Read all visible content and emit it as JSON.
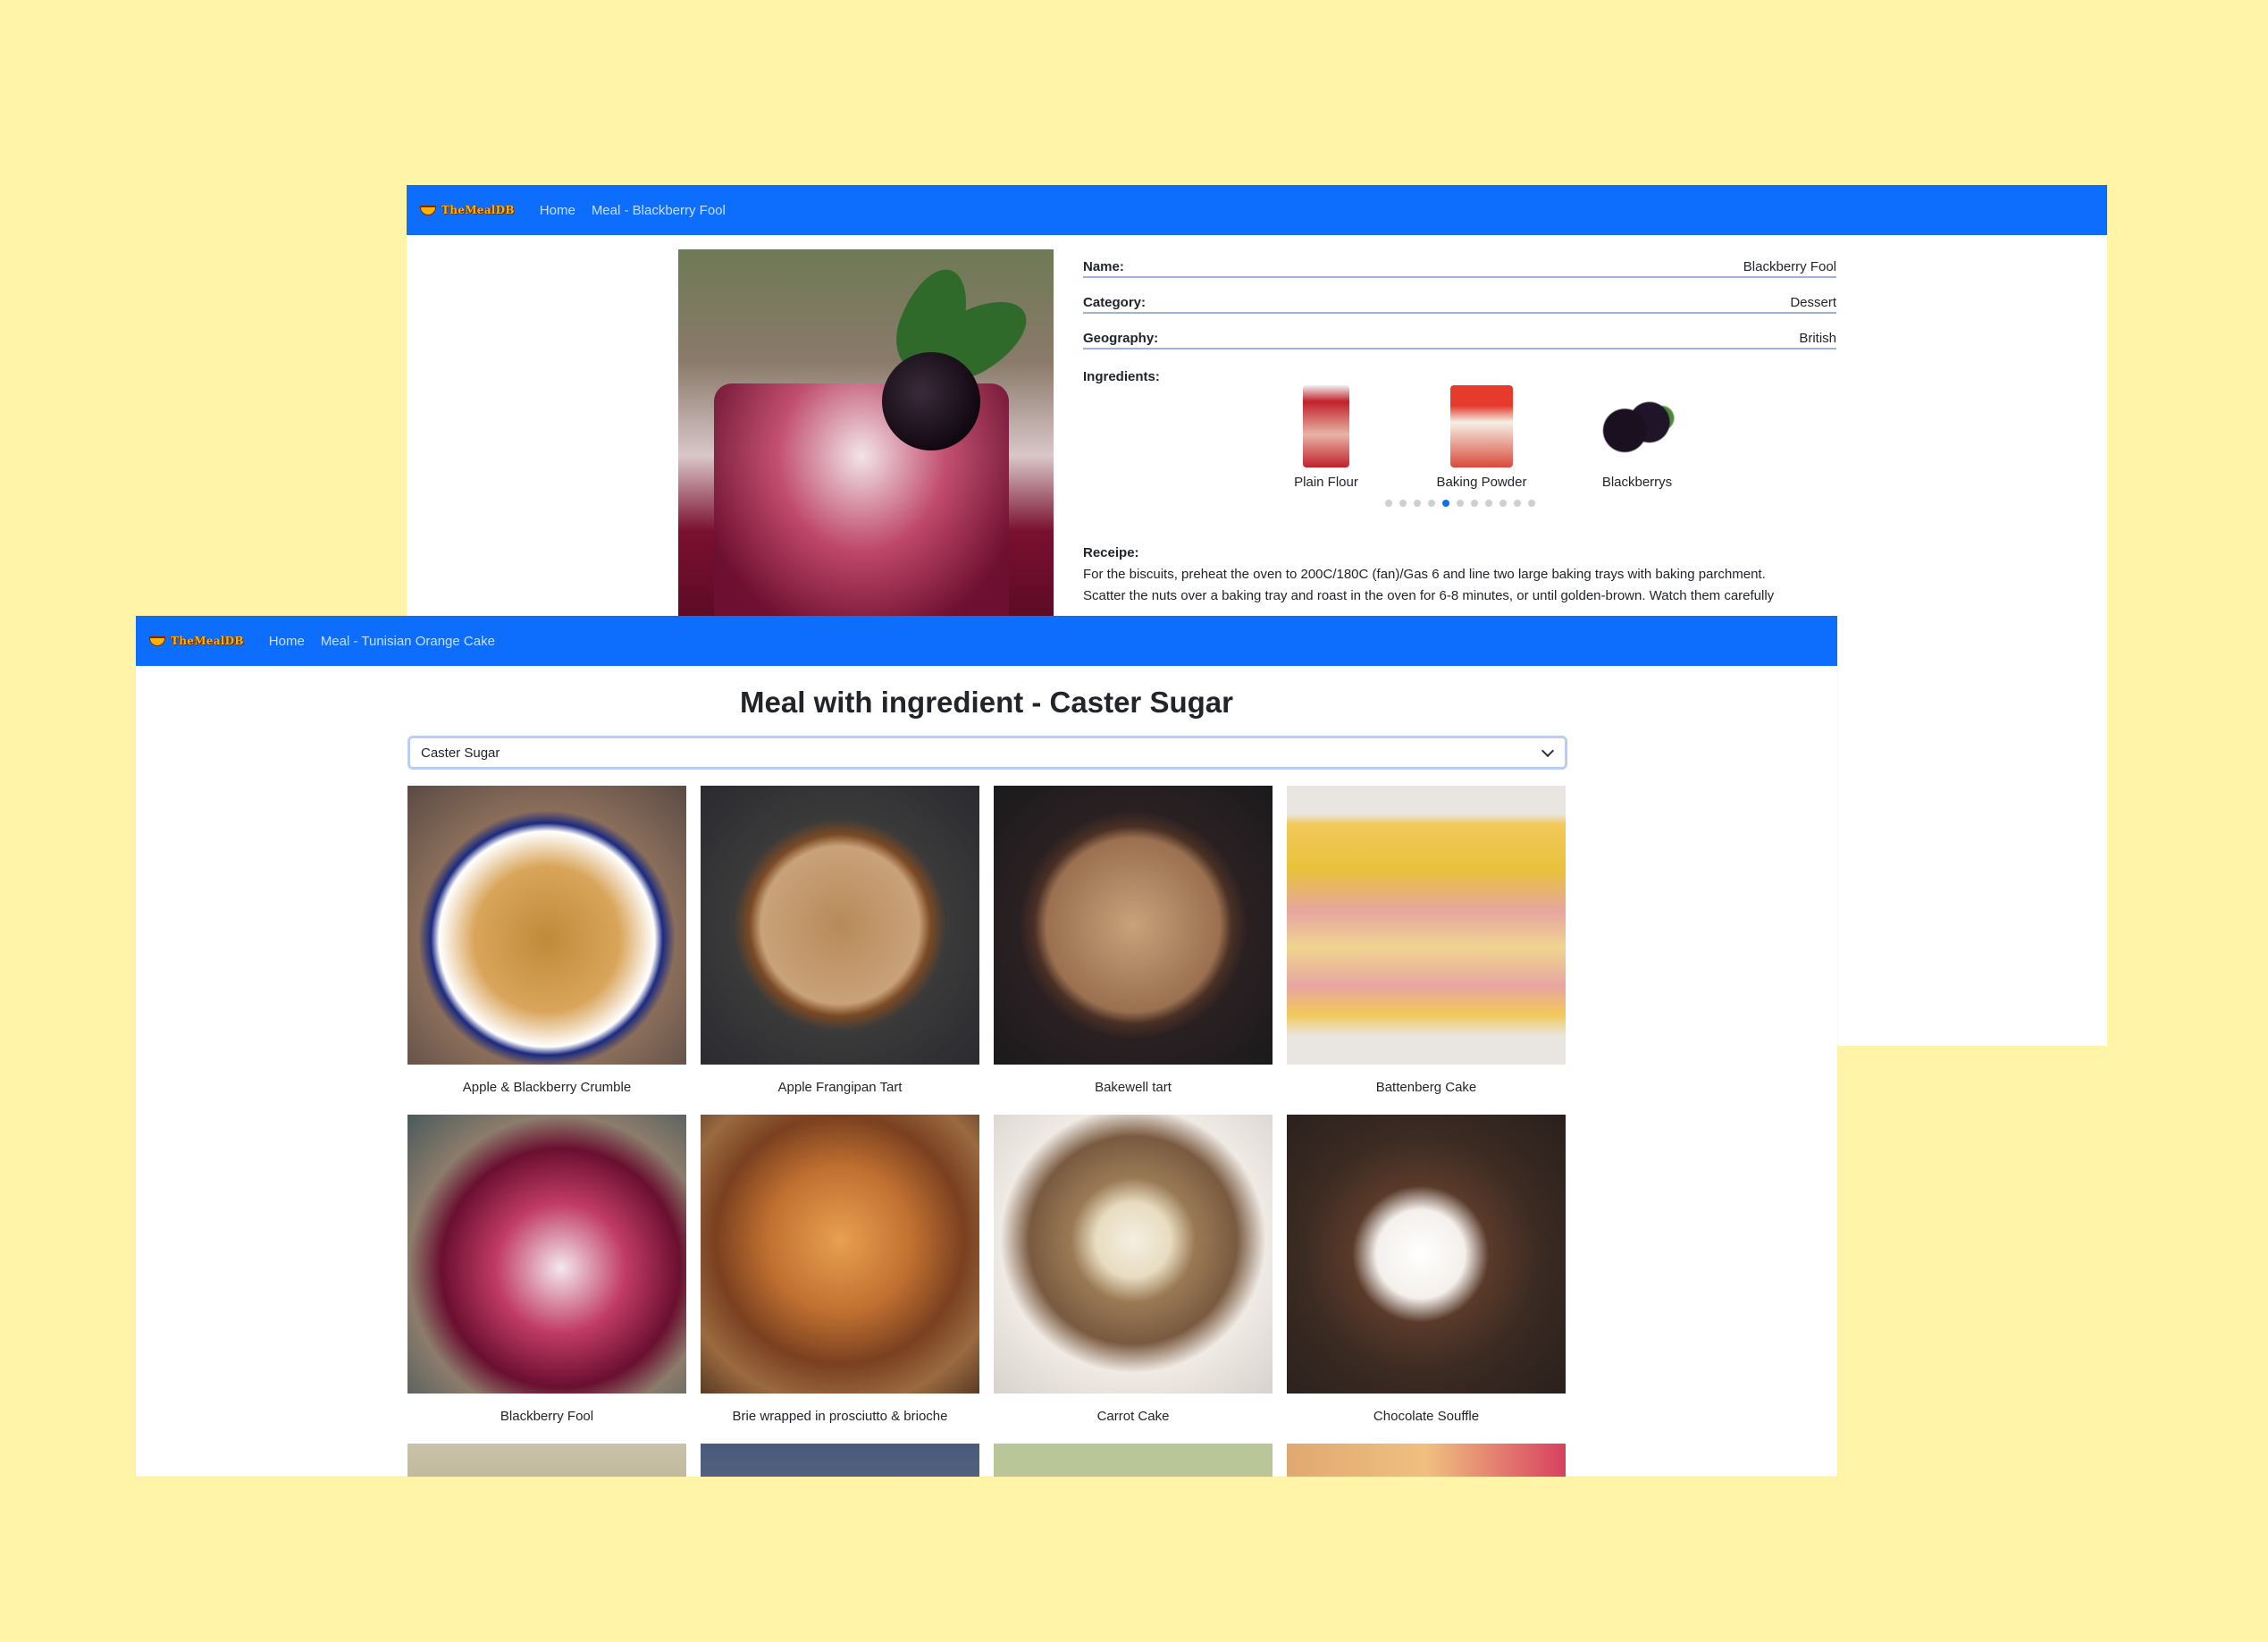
{
  "back_window": {
    "navbar": {
      "logo": "TheMealDB",
      "links": [
        "Home",
        "Meal - Blackberry Fool"
      ]
    },
    "details": {
      "name_label": "Name:",
      "name_value": "Blackberry Fool",
      "category_label": "Category:",
      "category_value": "Dessert",
      "geography_label": "Geography:",
      "geography_value": "British",
      "ingredients_label": "Ingredients:",
      "ingredients": [
        "Plain Flour",
        "Baking Powder",
        "Blackberrys"
      ],
      "carousel_dots_count": 11,
      "carousel_active_dot": 4,
      "receipe_label": "Receipe:",
      "receipe_lines": [
        "For the biscuits, preheat the oven to 200C/180C (fan)/Gas 6 and line two large baking trays with baking parchment.",
        "Scatter the nuts over a baking tray and roast in the oven for 6-8 minutes, or until golden-brown. Watch them carefully"
      ]
    }
  },
  "front_window": {
    "navbar": {
      "logo": "TheMealDB",
      "links": [
        "Home",
        "Meal - Tunisian Orange Cake"
      ]
    },
    "title": "Meal with ingredient - Caster Sugar",
    "select": {
      "value": "Caster Sugar"
    },
    "meals": [
      "Apple & Blackberry Crumble",
      "Apple Frangipan Tart",
      "Bakewell tart",
      "Battenberg Cake",
      "Blackberry Fool",
      "Brie wrapped in prosciutto & brioche",
      "Carrot Cake",
      "Chocolate Souffle"
    ]
  },
  "colors": {
    "background": "#fff4a8",
    "navbar": "#0d6efd",
    "accent": "#0d6efd"
  }
}
